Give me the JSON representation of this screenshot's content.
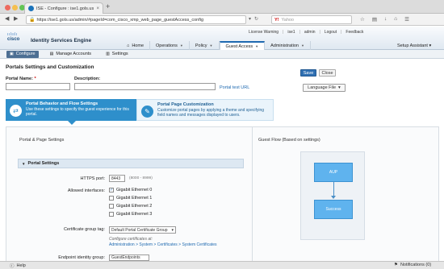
{
  "browser": {
    "tab_title": "ISE - Configure : ise1.gols.us",
    "url": "https://ise1.gols.us/admin/#pageId=com_cisco_xmp_web_page_guestAccess_config",
    "search_placeholder": "Yahoo"
  },
  "header": {
    "brand": "cisco",
    "product": "Identity Services Engine",
    "util_links": [
      "License Warning",
      "ise1",
      "admin",
      "Logout",
      "Feedback"
    ],
    "main_nav": [
      {
        "label": "Home",
        "icon": "home-icon"
      },
      {
        "label": "Operations"
      },
      {
        "label": "Policy"
      },
      {
        "label": "Guest Access",
        "active": true
      },
      {
        "label": "Administration"
      }
    ],
    "setup_assistant": "Setup Assistant"
  },
  "subnav": {
    "items": [
      {
        "label": "Configure",
        "active": true
      },
      {
        "label": "Manage Accounts"
      },
      {
        "label": "Settings"
      }
    ]
  },
  "page": {
    "title": "Portals Settings and Customization",
    "save_label": "Save",
    "close_label": "Close",
    "portal_name_label": "Portal Name:",
    "required_mark": "*",
    "description_label": "Description:",
    "portal_test_url": "Portal test URL",
    "language_file": "Language File"
  },
  "flow_tabs": [
    {
      "title": "Portal Behavior and Flow Settings",
      "desc": "Use these settings to specify the guest experience for this portal."
    },
    {
      "title": "Portal Page Customization",
      "desc": "Customize portal pages by applying a theme and specifying field names and messages displayed to users."
    }
  ],
  "section": {
    "left_header": "Portal & Page Settings",
    "right_header": "Guest Flow (Based on settings)",
    "portal_settings": "Portal Settings",
    "https_port_label": "HTTPS port:",
    "https_port_value": "8443",
    "https_port_hint": "(8000 - 8999)",
    "allowed_interfaces_label": "Allowed interfaces:",
    "interfaces": [
      {
        "label": "Gigabit Ethernet 0",
        "checked": true
      },
      {
        "label": "Gigabit Ethernet 1",
        "checked": false
      },
      {
        "label": "Gigabit Ethernet 2",
        "checked": false
      },
      {
        "label": "Gigabit Ethernet 3",
        "checked": false
      }
    ],
    "cert_group_label": "Certificate group tag:",
    "cert_group_value": "Default Portal Certificate Group",
    "configure_note": "Configure certificates at:",
    "configure_path": "Administration > System > Certificates > System Certificates",
    "endpoint_group_label": "Endpoint identity group:",
    "endpoint_group_value": "GuestEndpoints"
  },
  "guest_flow": {
    "steps": [
      "AUP",
      "Success"
    ]
  },
  "status": {
    "help": "Help",
    "notifications": "Notifications (0)"
  }
}
